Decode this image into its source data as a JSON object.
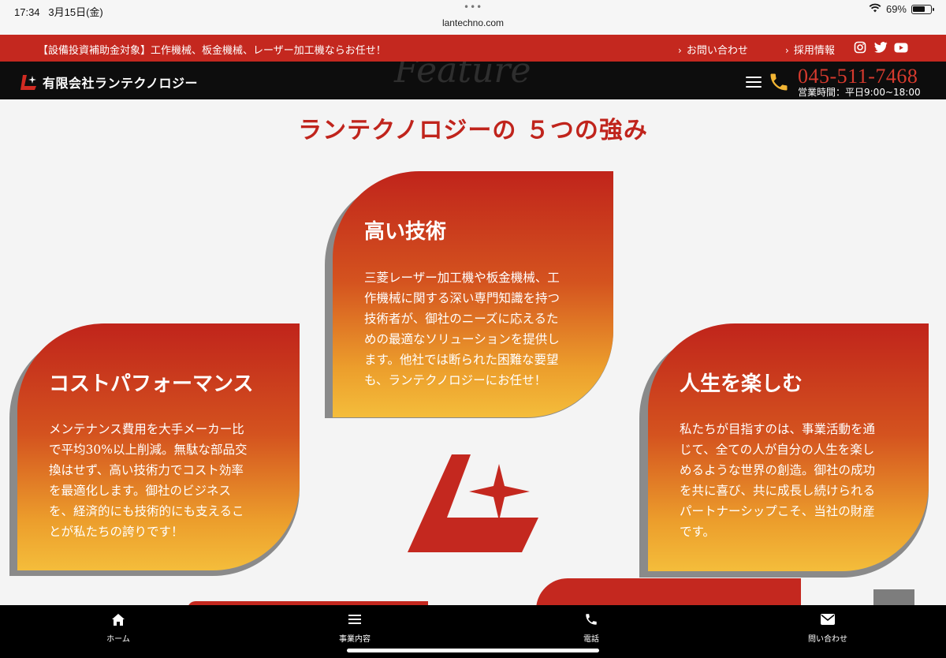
{
  "status_bar": {
    "time": "17:34",
    "date": "3月15日(金)",
    "url": "lantechno.com",
    "battery": "69%"
  },
  "topbar": {
    "notice": "【設備投資補助金対象】工作機械、板金機械、レーザー加工機ならお任せ！",
    "links": [
      "お問い合わせ",
      "採用情報"
    ],
    "social_icons": [
      "instagram-icon",
      "twitter-icon",
      "youtube-icon"
    ]
  },
  "header": {
    "logo_text": "有限会社ランテクノロジー",
    "ghost_text": "Feature",
    "phone": "045-511-7468",
    "hours": "営業時間：平日9:00~18:00"
  },
  "section": {
    "title": "ランテクノロジーの ５つの強み"
  },
  "cards": [
    {
      "title": "高い技術",
      "lines": [
        "三菱レーザー加工機や板金機械、工",
        "作機械に関する深い専門知識を持つ",
        "技術者が、御社のニーズに応えるた",
        "めの最適なソリューションを提供し",
        "ます。他社では断られた困難な要望",
        "も、ランテクノロジーにお任せ！"
      ]
    },
    {
      "title": "コストパフォーマンス",
      "lines": [
        "メンテナンス費用を大手メーカー比",
        "で平均30%以上削減。無駄な部品交",
        "換はせず、高い技術力でコスト効率",
        "を最適化します。御社のビジネス",
        "を、経済的にも技術的にも支えるこ",
        "とが私たちの誇りです！"
      ]
    },
    {
      "title": "人生を楽しむ",
      "lines": [
        "私たちが目指すのは、事業活動を通",
        "じて、全ての人が自分の人生を楽し",
        "めるような世界の創造。御社の成功",
        "を共に喜び、共に成長し続けられる",
        "パートナーシップこそ、当社の財産",
        "です。"
      ]
    }
  ],
  "bottom_nav": [
    {
      "label": "ホーム",
      "icon": "home-icon"
    },
    {
      "label": "事業内容",
      "icon": "menu-list-icon"
    },
    {
      "label": "電話",
      "icon": "phone-icon"
    },
    {
      "label": "問い合わせ",
      "icon": "mail-icon"
    }
  ],
  "colors": {
    "brand_red": "#c4281f",
    "card_gradient_top": "#c0241b",
    "card_gradient_bottom": "#f4bd3b",
    "header_black": "#0d0d0d"
  }
}
